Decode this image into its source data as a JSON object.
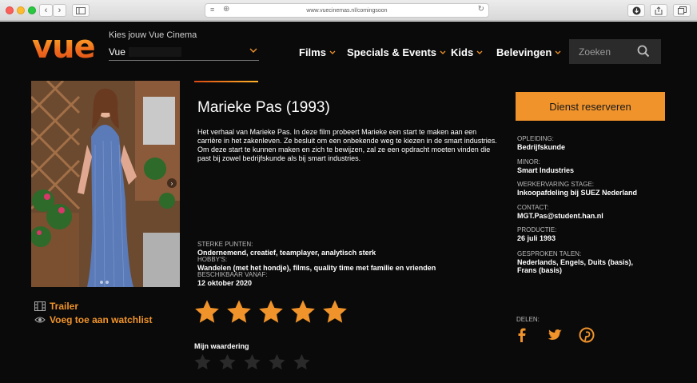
{
  "browser": {
    "url": "www.vuecinemas.nl/comingsoon"
  },
  "header": {
    "logo_text": "vue",
    "cinema_label": "Kies jouw Vue Cinema",
    "cinema_value": "Vue",
    "nav": [
      {
        "label": "Films"
      },
      {
        "label": "Specials & Events"
      },
      {
        "label": "Kids"
      },
      {
        "label": "Belevingen"
      }
    ],
    "search_placeholder": "Zoeken"
  },
  "sidebar": {
    "trailer_label": "Trailer",
    "watchlist_label": "Voeg toe aan watchlist"
  },
  "main": {
    "title": "Marieke Pas (1993)",
    "synopsis": "Het verhaal van Marieke Pas. In deze film probeert Marieke een start te maken aan een carrière in het zakenleven. Ze besluit om een onbekende weg te kiezen in de smart industries. Om deze start te kunnen maken en zich te bewijzen, zal ze een opdracht moeten vinden die past bij zowel bedrijfskunde als bij smart industries.",
    "fields": [
      {
        "label": "STERKE PUNTEN:",
        "value": "Ondernemend, creatief, teamplayer, analytisch sterk"
      },
      {
        "label": "HOBBY'S:",
        "value": "Wandelen (met het hondje), films, quality time met familie en vrienden"
      },
      {
        "label": "BESCHIKBAAR VANAF:",
        "value": "12 oktober 2020"
      }
    ],
    "rating": 5,
    "my_rating_label": "Mijn waardering",
    "my_rating": 0
  },
  "details": {
    "reserve_label": "Dienst reserveren",
    "items": [
      {
        "label": "OPLEIDING:",
        "value": "Bedrijfskunde"
      },
      {
        "label": "MINOR:",
        "value": "Smart Industries"
      },
      {
        "label": "WERKERVARING STAGE:",
        "value": "Inkoopafdeling bij SUEZ Nederland"
      },
      {
        "label": "CONTACT:",
        "value": "MGT.Pas@student.han.nl"
      },
      {
        "label": "PRODUCTIE:",
        "value": "26 juli 1993"
      },
      {
        "label": "GESPROKEN TALEN:",
        "value": "Nederlands, Engels, Duits (basis),",
        "value2": "Frans (basis)"
      }
    ],
    "share_label": "DELEN:"
  },
  "colors": {
    "accent": "#f0932b",
    "background": "#0a0a0a"
  }
}
